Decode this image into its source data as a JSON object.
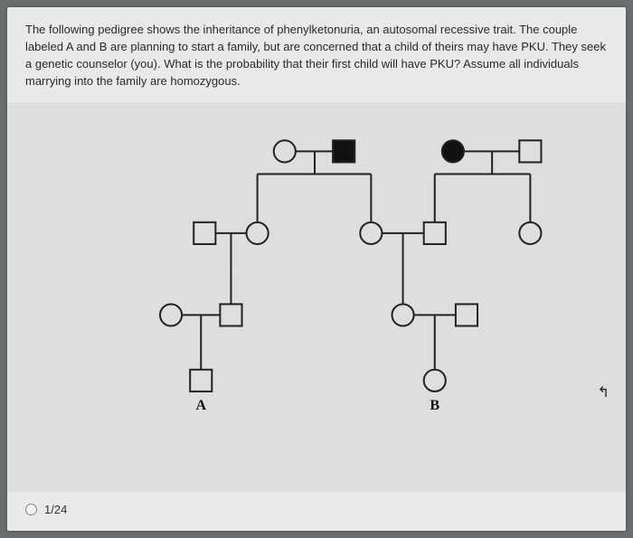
{
  "question": "The following pedigree shows the inheritance of phenylketonuria, an autosomal recessive trait. The couple labeled A and B are planning to start a family, but are concerned that a child of theirs may have PKU. They seek a genetic counselor (you). What is the probability that their first child will have PKU? Assume all individuals marrying into the family are homozygous.",
  "labels": {
    "a": "A",
    "b": "B"
  },
  "answer_option": "1/24",
  "chart_data": {
    "type": "pedigree",
    "generations": [
      {
        "gen": 1,
        "couples": [
          {
            "id": "c1",
            "left": {
              "sex": "F",
              "affected": false
            },
            "right": {
              "sex": "M",
              "affected": true
            }
          },
          {
            "id": "c2",
            "left": {
              "sex": "F",
              "affected": true
            },
            "right": {
              "sex": "M",
              "affected": false
            }
          }
        ]
      },
      {
        "gen": 2,
        "couples": [
          {
            "id": "c3",
            "left": {
              "sex": "M",
              "affected": false,
              "marry_in": true
            },
            "right": {
              "sex": "F",
              "affected": false,
              "parent": "c1"
            }
          },
          {
            "id": "c4",
            "left": {
              "sex": "F",
              "affected": false,
              "parent": "c1"
            },
            "right": {
              "sex": "M",
              "affected": false,
              "parent": "c2"
            }
          },
          {
            "id": "c5",
            "right_only": {
              "sex": "F",
              "affected": false,
              "parent": "c2"
            }
          }
        ]
      },
      {
        "gen": 3,
        "couples": [
          {
            "id": "c6",
            "left": {
              "sex": "F",
              "affected": false,
              "marry_in": true
            },
            "right": {
              "sex": "M",
              "affected": false,
              "parent": "c3"
            }
          },
          {
            "id": "c7",
            "left": {
              "sex": "F",
              "affected": false,
              "parent": "c4"
            },
            "right": {
              "sex": "M",
              "affected": false,
              "marry_in": true
            }
          }
        ]
      },
      {
        "gen": 4,
        "individuals": [
          {
            "id": "A",
            "sex": "M",
            "affected": false,
            "parent": "c6",
            "label": "A"
          },
          {
            "id": "B",
            "sex": "F",
            "affected": false,
            "parent": "c7",
            "label": "B"
          }
        ]
      }
    ]
  }
}
